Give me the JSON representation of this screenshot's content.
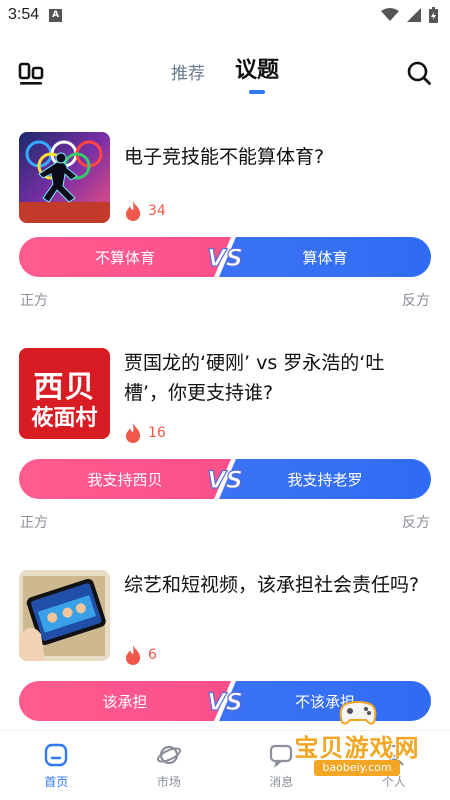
{
  "status": {
    "time": "3:54",
    "notif_glyph": "A"
  },
  "header": {
    "tabs": [
      {
        "label": "推荐"
      },
      {
        "label": "议题"
      }
    ]
  },
  "topics": [
    {
      "title": "电子竞技能不能算体育?",
      "heat": "34",
      "left_option": "不算体育",
      "right_option": "算体育",
      "left_side": "正方",
      "right_side": "反方",
      "thumb": "runner-image"
    },
    {
      "title": "贾国龙的‘硬刚’ vs 罗永浩的‘吐槽’，你更支持谁?",
      "heat": "16",
      "left_option": "我支持西贝",
      "right_option": "我支持老罗",
      "left_side": "正方",
      "right_side": "反方",
      "thumb_logo_line1": "西贝",
      "thumb_logo_line2": "莜面村"
    },
    {
      "title": "综艺和短视频，该承担社会责任吗?",
      "heat": "6",
      "left_option": "该承担",
      "right_option": "不该承担",
      "thumb": "phone-variety-show-image"
    }
  ],
  "vs_text": "VS",
  "bottom_nav": [
    {
      "label": "首页",
      "icon": "home-icon",
      "active": true
    },
    {
      "label": "市场",
      "icon": "planet-icon"
    },
    {
      "label": "消息",
      "icon": "message-icon"
    },
    {
      "label": "个人",
      "icon": "person-icon"
    }
  ],
  "watermark": {
    "text": "宝贝游戏网",
    "url": "baobeiy.com"
  },
  "colors": {
    "accent": "#2f79f1",
    "pink": "#fb4f8a",
    "blue": "#2f6cf3",
    "heat": "#f0584a"
  }
}
